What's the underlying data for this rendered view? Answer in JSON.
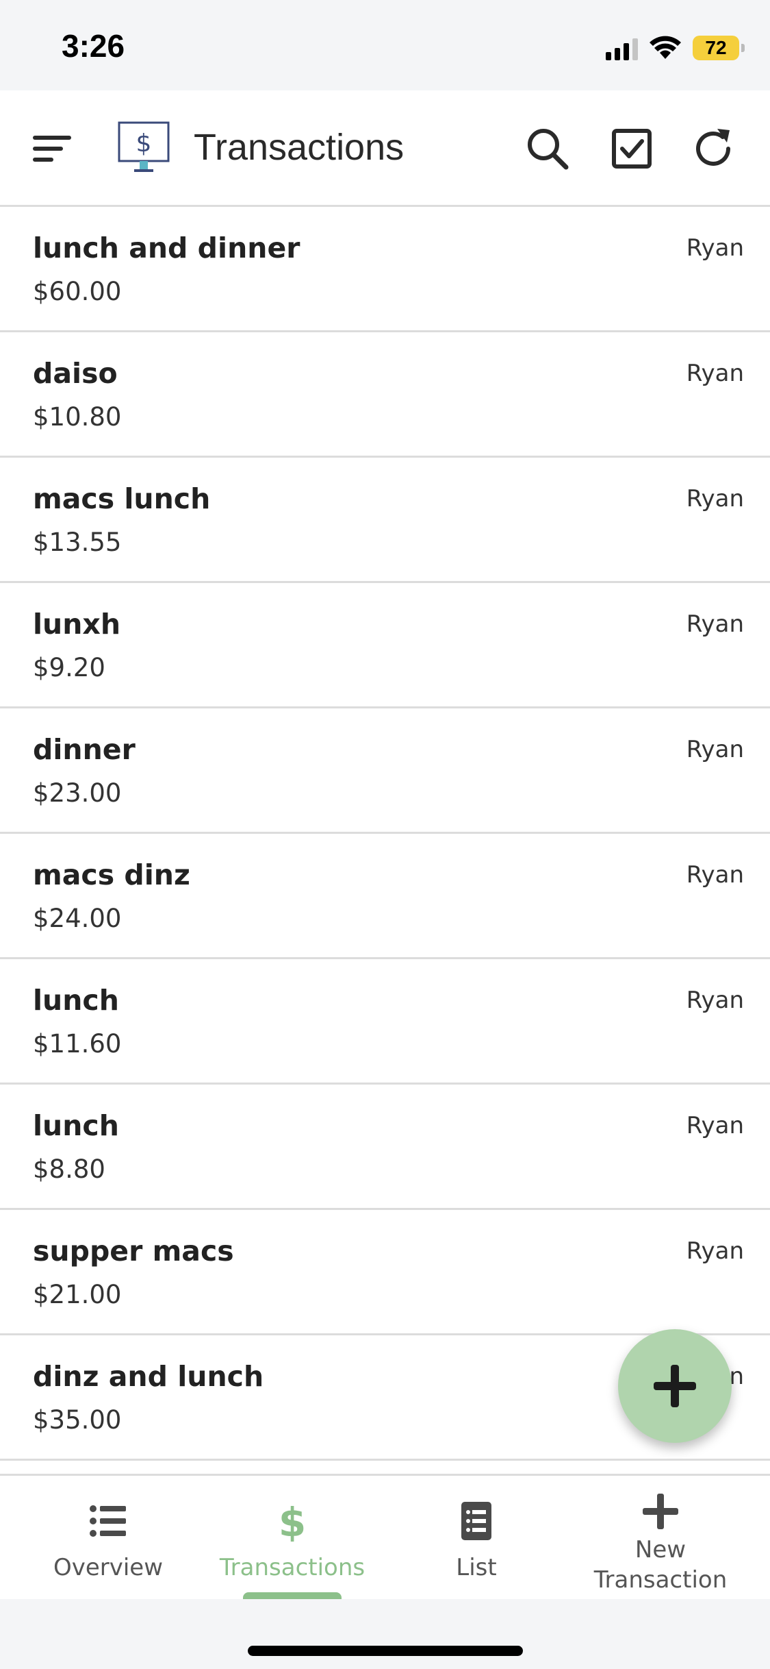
{
  "status_bar": {
    "time": "3:26",
    "battery": "72"
  },
  "app_bar": {
    "title": "Transactions"
  },
  "transactions": [
    {
      "name": "lunch and dinner",
      "amount": "$60.00",
      "user": "Ryan"
    },
    {
      "name": "daiso",
      "amount": "$10.80",
      "user": "Ryan"
    },
    {
      "name": "macs lunch",
      "amount": "$13.55",
      "user": "Ryan"
    },
    {
      "name": "lunxh",
      "amount": "$9.20",
      "user": "Ryan"
    },
    {
      "name": "dinner",
      "amount": "$23.00",
      "user": "Ryan"
    },
    {
      "name": "macs dinz",
      "amount": "$24.00",
      "user": "Ryan"
    },
    {
      "name": "lunch",
      "amount": "$11.60",
      "user": "Ryan"
    },
    {
      "name": "lunch",
      "amount": "$8.80",
      "user": "Ryan"
    },
    {
      "name": "supper macs",
      "amount": "$21.00",
      "user": "Ryan"
    },
    {
      "name": "dinz and lunch",
      "amount": "$35.00",
      "user": "n"
    }
  ],
  "bottom_nav": {
    "overview": "Overview",
    "transactions": "Transactions",
    "list": "List",
    "new_transaction_line1": "New",
    "new_transaction_line2": "Transaction"
  },
  "colors": {
    "accent": "#8cc08a",
    "fab": "#b0d4ad",
    "divider": "#dcdcdc",
    "battery": "#f5cf3c"
  },
  "icons": [
    "menu-icon",
    "app-logo-icon",
    "search-icon",
    "checkbox-icon",
    "refresh-icon",
    "plus-icon",
    "list-bullets-icon",
    "dollar-icon",
    "document-list-icon"
  ]
}
